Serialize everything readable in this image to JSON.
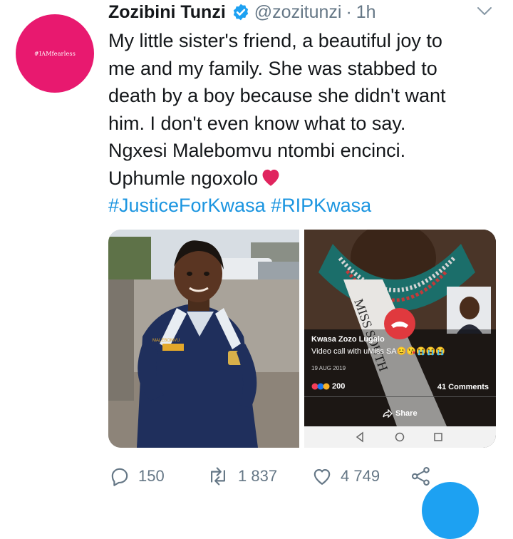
{
  "tweet": {
    "avatar_text": "#IAMfearless",
    "author_name": "Zozibini Tunzi",
    "handle": "@zozitunzi",
    "separator": "·",
    "time": "1h",
    "lines": [
      "My little sister's friend, a beautiful joy to",
      "me and my family. She was stabbed to",
      "death by a boy because she didn't want",
      "him. I don't even know what to say.",
      "Ngxesi Malebomvu ntombi encinci.",
      "Uphumle ngoxolo"
    ],
    "hashtags": "#JusticeForKwasa #RIPKwasa",
    "media": {
      "jacket_text": "MALEBOMVU",
      "fb_name": "Kwasa Zozo Lugalo",
      "fb_subtitle": "Video call with uMiss SA",
      "fb_emojis": "😊😘😭😭😭",
      "fb_date": "19 AUG 2019",
      "fb_reactions": "200",
      "fb_comments": "41 Comments",
      "fb_share": "Share",
      "sash_text": "MISS SOUTH"
    },
    "actions": {
      "replies": "150",
      "retweets": "1 837",
      "likes": "4 749"
    },
    "colors": {
      "avatar_bg": "#e8196f",
      "verified": "#1da1f2",
      "link": "#1b95e0",
      "muted": "#657786",
      "heart": "#e0245e"
    }
  }
}
